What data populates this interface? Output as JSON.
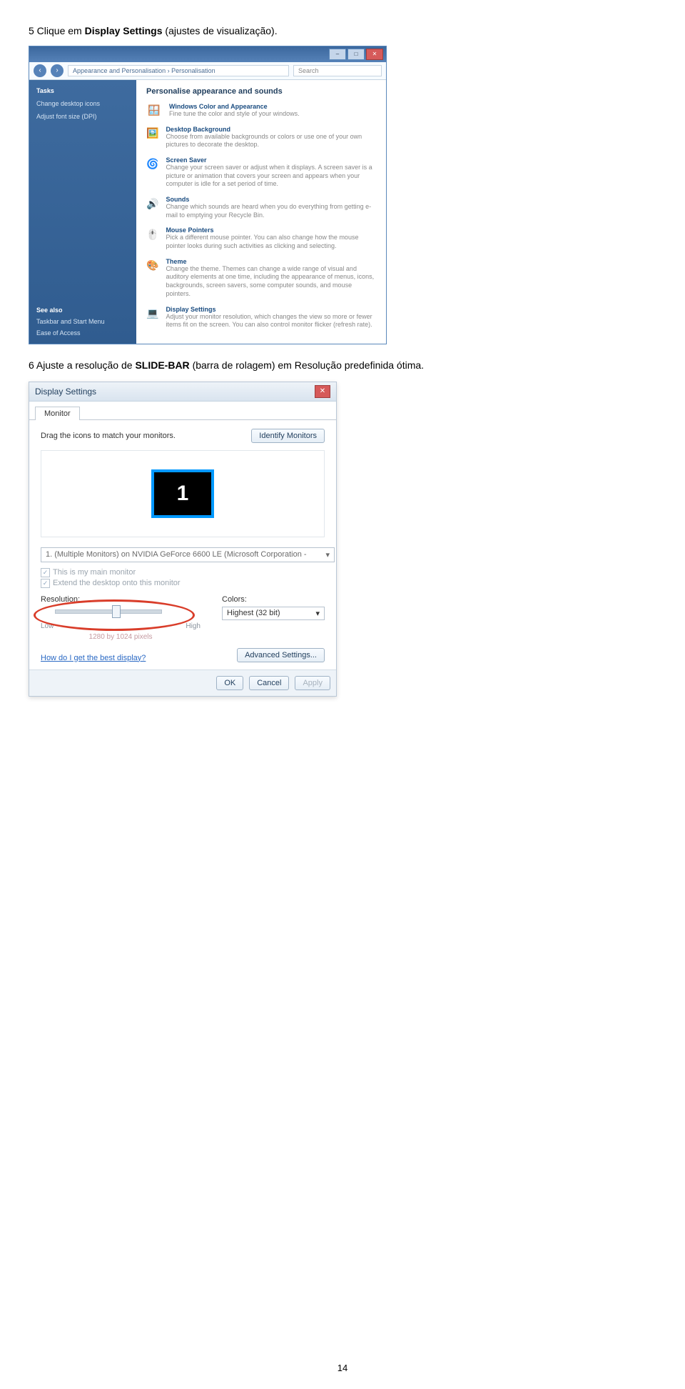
{
  "step5": {
    "pre": "5 Clique em ",
    "bold": "Display Settings",
    "post": " (ajustes de visualização)."
  },
  "shot1": {
    "breadcrumb": "Appearance and Personalisation  ›  Personalisation",
    "search_placeholder": "Search",
    "tasks_heading": "Tasks",
    "tasks": [
      "Change desktop icons",
      "Adjust font size (DPI)"
    ],
    "see_also": "See also",
    "see_also_items": [
      "Taskbar and Start Menu",
      "Ease of Access"
    ],
    "main_heading": "Personalise appearance and sounds",
    "items": [
      {
        "icon": "🪟",
        "title": "Windows Color and Appearance",
        "desc": "Fine tune the color and style of your windows."
      },
      {
        "icon": "🖼️",
        "title": "Desktop Background",
        "desc": "Choose from available backgrounds or colors or use one of your own pictures to decorate the desktop."
      },
      {
        "icon": "🌀",
        "title": "Screen Saver",
        "desc": "Change your screen saver or adjust when it displays. A screen saver is a picture or animation that covers your screen and appears when your computer is idle for a set period of time."
      },
      {
        "icon": "🔊",
        "title": "Sounds",
        "desc": "Change which sounds are heard when you do everything from getting e-mail to emptying your Recycle Bin."
      },
      {
        "icon": "🖱️",
        "title": "Mouse Pointers",
        "desc": "Pick a different mouse pointer. You can also change how the mouse pointer looks during such activities as clicking and selecting."
      },
      {
        "icon": "🎨",
        "title": "Theme",
        "desc": "Change the theme. Themes can change a wide range of visual and auditory elements at one time, including the appearance of menus, icons, backgrounds, screen savers, some computer sounds, and mouse pointers."
      },
      {
        "icon": "💻",
        "title": "Display Settings",
        "desc": "Adjust your monitor resolution, which changes the view so more or fewer items fit on the screen. You can also control monitor flicker (refresh rate)."
      }
    ]
  },
  "step6": {
    "pre": "6 Ajuste a resolução de ",
    "bold": "SLIDE-BAR",
    "post": " (barra de rolagem) em Resolução predefinida ótima."
  },
  "shot2": {
    "title": "Display Settings",
    "tab": "Monitor",
    "drag_text": "Drag the icons to match your monitors.",
    "identify": "Identify Monitors",
    "monitor_number": "1",
    "combo_value": "1. (Multiple Monitors) on NVIDIA GeForce 6600 LE (Microsoft Corporation -",
    "chk1": "This is my main monitor",
    "chk2": "Extend the desktop onto this monitor",
    "resolution_label": "Resolution:",
    "low": "Low",
    "high": "High",
    "res_readout": "1280 by 1024 pixels",
    "colors_label": "Colors:",
    "colors_value": "Highest (32 bit)",
    "helplink": "How do I get the best display?",
    "advanced": "Advanced Settings...",
    "ok": "OK",
    "cancel": "Cancel",
    "apply": "Apply"
  },
  "page_number": "14"
}
